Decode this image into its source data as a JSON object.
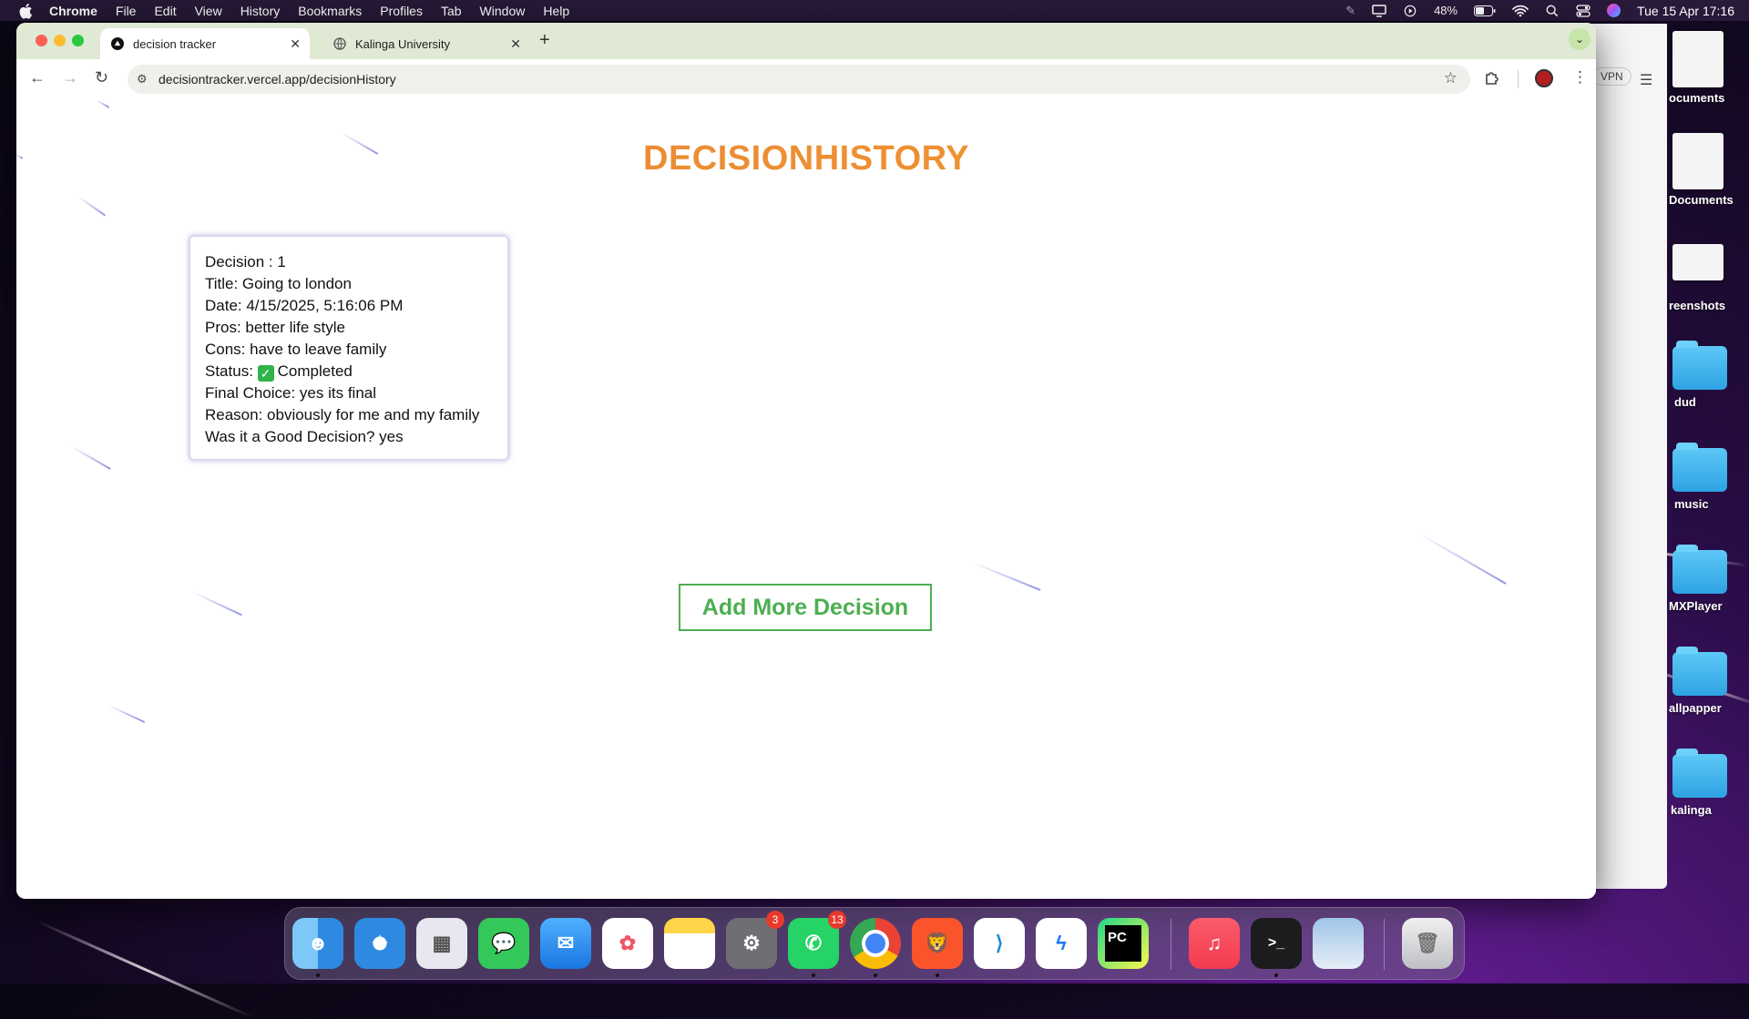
{
  "menubar": {
    "app_name": "Chrome",
    "menus": [
      "File",
      "Edit",
      "View",
      "History",
      "Bookmarks",
      "Profiles",
      "Tab",
      "Window",
      "Help"
    ],
    "battery": "48%",
    "datetime": "Tue 15 Apr  17:16"
  },
  "desktop": {
    "items": [
      {
        "label": "ocuments",
        "kind": "doc"
      },
      {
        "label": "Documents",
        "kind": "pdf"
      },
      {
        "label": "reenshots",
        "kind": "screen"
      },
      {
        "label": "dud",
        "kind": "folder"
      },
      {
        "label": "music",
        "kind": "folder"
      },
      {
        "label": "MXPlayer",
        "kind": "folder"
      },
      {
        "label": "allpapper",
        "kind": "folder"
      },
      {
        "label": "kalinga",
        "kind": "folder"
      }
    ]
  },
  "back_window": {
    "vpn_label": "VPN"
  },
  "browser": {
    "tabs": [
      {
        "title": "decision tracker",
        "active": true
      },
      {
        "title": "Kalinga University",
        "active": false
      }
    ],
    "url": "decisiontracker.vercel.app/decisionHistory"
  },
  "page": {
    "title": "DECISIONHISTORY",
    "decision": {
      "number_line": "Decision : 1",
      "title_line": "Title: Going to london",
      "date_line": "Date: 4/15/2025, 5:16:06 PM",
      "pros_line": "Pros: better life style",
      "cons_line": "Cons: have to leave family",
      "status_prefix": "Status:",
      "status_value": "Completed",
      "final_choice_line": "Final Choice: yes its final",
      "reason_line": "Reason: obviously for me and my family",
      "good_decision_line": "Was it a Good Decision? yes"
    },
    "add_button_label": "Add More Decision"
  },
  "dock": {
    "apps": [
      {
        "name": "Finder",
        "badge": ""
      },
      {
        "name": "Safari",
        "badge": ""
      },
      {
        "name": "Launchpad",
        "badge": ""
      },
      {
        "name": "Messages",
        "badge": ""
      },
      {
        "name": "Mail",
        "badge": ""
      },
      {
        "name": "Photos",
        "badge": ""
      },
      {
        "name": "Notes",
        "badge": ""
      },
      {
        "name": "System Settings",
        "badge": "3"
      },
      {
        "name": "WhatsApp",
        "badge": "13"
      },
      {
        "name": "Chrome",
        "badge": ""
      },
      {
        "name": "Brave",
        "badge": ""
      },
      {
        "name": "VS Code",
        "badge": ""
      },
      {
        "name": "Messenger",
        "badge": ""
      },
      {
        "name": "PyCharm",
        "badge": ""
      },
      {
        "name": "Music",
        "badge": ""
      },
      {
        "name": "Terminal",
        "badge": ""
      },
      {
        "name": "Preview",
        "badge": ""
      },
      {
        "name": "Trash",
        "badge": ""
      }
    ]
  }
}
